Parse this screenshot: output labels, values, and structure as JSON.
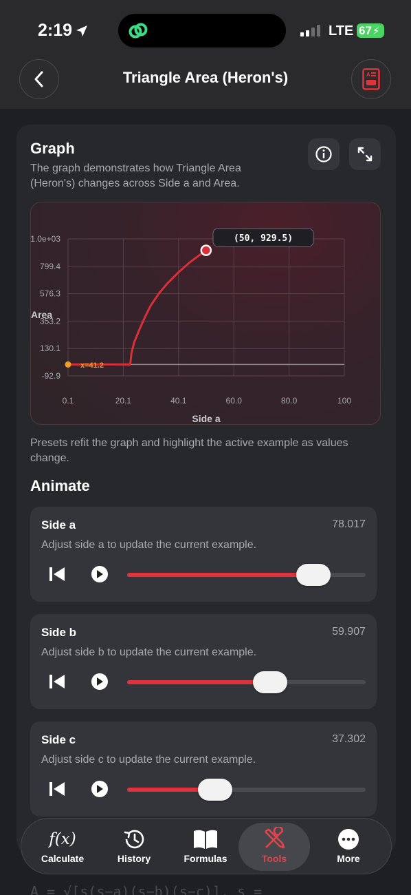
{
  "status": {
    "time": "2:19",
    "network": "LTE",
    "battery": "67"
  },
  "header": {
    "title": "Triangle Area (Heron's)"
  },
  "graph": {
    "title": "Graph",
    "description": "The graph demonstrates how Triangle Area (Heron's) changes across Side a and Area.",
    "tooltip": "(50, 929.5)",
    "marker_label": "x=41.2"
  },
  "chart_data": {
    "type": "line",
    "xlabel": "Side a",
    "ylabel": "Area",
    "x_ticks": [
      "0.1",
      "20.1",
      "40.1",
      "60.0",
      "80.0",
      "100"
    ],
    "y_ticks": [
      "1.0e+03",
      "799.4",
      "576.3",
      "353.2",
      "130.1",
      "-92.9"
    ],
    "xlim": [
      0.1,
      100
    ],
    "ylim": [
      -92.9,
      1022.6
    ],
    "grid": true,
    "series": [
      {
        "color": "#d9303a",
        "x": [
          0.1,
          22.6,
          22.6,
          23.0,
          24.0,
          26.0,
          28.0,
          30.0,
          33.0,
          36.0,
          40.0,
          44.0,
          47.0,
          50.0
        ],
        "y": [
          0,
          0,
          0,
          90,
          180,
          290,
          390,
          480,
          580,
          660,
          750,
          830,
          880,
          929.5
        ]
      }
    ],
    "highlight_point": {
      "x": 50,
      "y": 929.5
    },
    "start_point": {
      "x": 0.1,
      "y": 0
    }
  },
  "notes": {
    "preset": "Presets refit the graph and highlight the active example as values change."
  },
  "animate": {
    "title": "Animate",
    "sliders": [
      {
        "name": "Side a",
        "value": "78.017",
        "description": "Adjust side a to update the current example.",
        "fraction": 0.78
      },
      {
        "name": "Side b",
        "value": "59.907",
        "description": "Adjust side b to update the current example.",
        "fraction": 0.6
      },
      {
        "name": "Side c",
        "value": "37.302",
        "description": "Adjust side c to update the current example.",
        "fraction": 0.37
      }
    ]
  },
  "formula_peek": "A = √[s(s−a)(s−b)(s−c)],  s =",
  "tabs": [
    {
      "label": "Calculate",
      "icon": "function-icon"
    },
    {
      "label": "History",
      "icon": "history-icon"
    },
    {
      "label": "Formulas",
      "icon": "book-icon"
    },
    {
      "label": "Tools",
      "icon": "tools-icon"
    },
    {
      "label": "More",
      "icon": "more-icon"
    }
  ],
  "colors": {
    "accent": "#e0323a",
    "background": "#1e1f22",
    "card": "#27282c",
    "battery": "#4bd364"
  }
}
